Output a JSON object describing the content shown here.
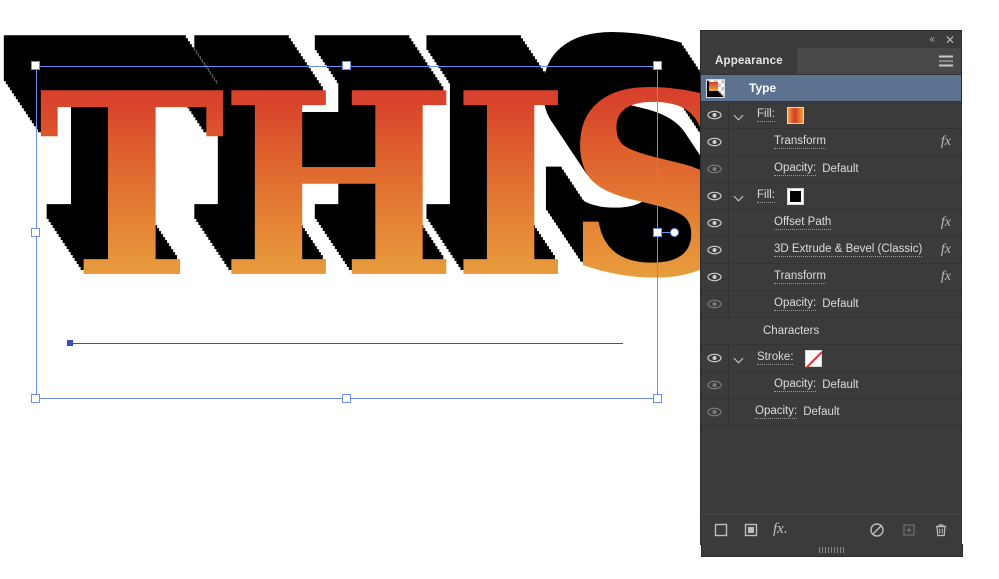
{
  "artwork": {
    "text": "THIS",
    "face_gradient_start": "#d8392a",
    "face_gradient_end": "#eaab41",
    "extrude_color": "#000000",
    "selection_color": "#6d8ef0",
    "baseline_color": "#3a4fb5"
  },
  "panel": {
    "tab_label": "Appearance",
    "collapse_icon": "chevron-double-left-icon",
    "close_icon": "close-icon",
    "menu_icon": "hamburger-menu-icon",
    "rows": [
      {
        "label": "Type",
        "value": "",
        "type": "header",
        "eye": "none",
        "chevron": false,
        "swatch": "none",
        "fx": false
      },
      {
        "label": "Fill:",
        "value": "",
        "type": "fill",
        "eye": "on",
        "chevron": true,
        "swatch": "gradient",
        "fx": false
      },
      {
        "label": "Transform",
        "value": "",
        "type": "effect",
        "eye": "on",
        "chevron": false,
        "swatch": "none",
        "fx": true
      },
      {
        "label": "Opacity:",
        "value": "Default",
        "type": "opacity",
        "eye": "dim",
        "chevron": false,
        "swatch": "none",
        "fx": false
      },
      {
        "label": "Fill:",
        "value": "",
        "type": "fill",
        "eye": "on",
        "chevron": true,
        "swatch": "black",
        "fx": false
      },
      {
        "label": "Offset Path",
        "value": "",
        "type": "effect",
        "eye": "on",
        "chevron": false,
        "swatch": "none",
        "fx": true
      },
      {
        "label": "3D Extrude & Bevel (Classic)",
        "value": "",
        "type": "effect",
        "eye": "on",
        "chevron": false,
        "swatch": "none",
        "fx": true
      },
      {
        "label": "Transform",
        "value": "",
        "type": "effect",
        "eye": "on",
        "chevron": false,
        "swatch": "none",
        "fx": true
      },
      {
        "label": "Opacity:",
        "value": "Default",
        "type": "opacity",
        "eye": "dim",
        "chevron": false,
        "swatch": "none",
        "fx": false
      },
      {
        "label": "Characters",
        "value": "",
        "type": "group",
        "eye": "none",
        "chevron": false,
        "swatch": "none",
        "fx": false
      },
      {
        "label": "Stroke:",
        "value": "",
        "type": "stroke",
        "eye": "on",
        "chevron": true,
        "swatch": "none-swatch",
        "fx": false
      },
      {
        "label": "Opacity:",
        "value": "Default",
        "type": "opacity",
        "eye": "dim",
        "chevron": false,
        "swatch": "none",
        "fx": false
      },
      {
        "label": "Opacity:",
        "value": "Default",
        "type": "opacity-root",
        "eye": "dim",
        "chevron": false,
        "swatch": "none",
        "fx": false
      }
    ],
    "footer": {
      "add_new_stroke": "add-new-stroke-icon",
      "add_new_fill": "add-new-fill-icon",
      "add_new_effect": "fx-icon",
      "clear_appearance": "clear-appearance-icon",
      "duplicate_item": "duplicate-item-icon",
      "delete_item": "trash-icon"
    }
  }
}
